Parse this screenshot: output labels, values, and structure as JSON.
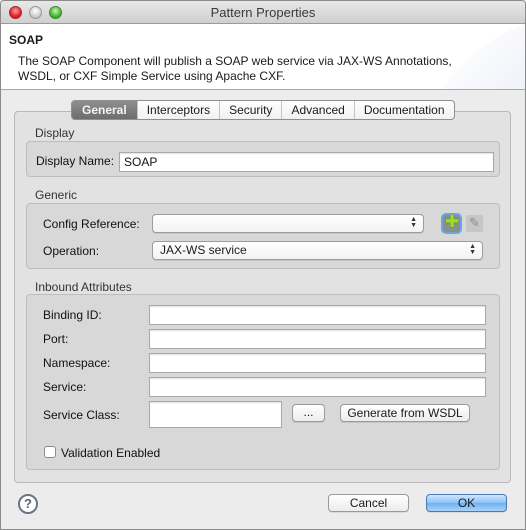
{
  "window": {
    "title": "Pattern Properties",
    "controls": [
      "close",
      "minimize",
      "zoom"
    ]
  },
  "header": {
    "title": "SOAP",
    "description": "The SOAP Component will publish a SOAP web service via JAX-WS Annotations, WSDL, or CXF Simple Service using Apache CXF."
  },
  "tabs": [
    {
      "label": "General",
      "active": true
    },
    {
      "label": "Interceptors",
      "active": false
    },
    {
      "label": "Security",
      "active": false
    },
    {
      "label": "Advanced",
      "active": false
    },
    {
      "label": "Documentation",
      "active": false
    }
  ],
  "display": {
    "section_label": "Display",
    "display_name_label": "Display Name:",
    "display_name_value": "SOAP"
  },
  "generic": {
    "section_label": "Generic",
    "config_reference_label": "Config Reference:",
    "config_reference_value": "",
    "operation_label": "Operation:",
    "operation_value": "JAX-WS service",
    "add_icon": "plus-icon",
    "edit_icon": "pencil-icon"
  },
  "inbound": {
    "section_label": "Inbound Attributes",
    "binding_id_label": "Binding ID:",
    "binding_id_value": "",
    "port_label": "Port:",
    "port_value": "",
    "namespace_label": "Namespace:",
    "namespace_value": "",
    "service_label": "Service:",
    "service_value": "",
    "service_class_label": "Service Class:",
    "service_class_value": "",
    "browse_label": "...",
    "generate_label": "Generate from WSDL",
    "validation_label": "Validation Enabled",
    "validation_checked": false
  },
  "footer": {
    "help_icon": "help-icon",
    "help_glyph": "?",
    "cancel_label": "Cancel",
    "ok_label": "OK"
  }
}
